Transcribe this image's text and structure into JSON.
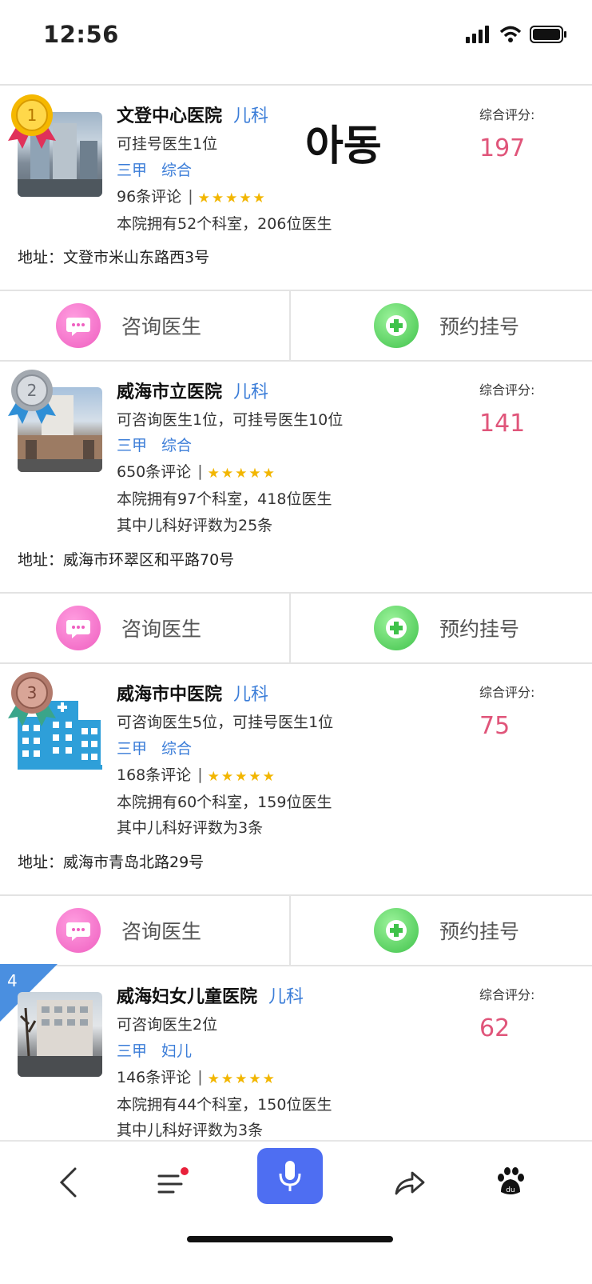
{
  "status_bar": {
    "time": "12:56"
  },
  "overlay_text": "아동",
  "labels": {
    "score_label": "综合评分:",
    "consult": "咨询医生",
    "appointment": "预约挂号"
  },
  "hospitals": [
    {
      "rank": "1",
      "medal": "gold",
      "name": "文登中心医院",
      "dept": "儿科",
      "doctors": "可挂号医生1位",
      "grade": "三甲",
      "type": "综合",
      "reviews": "96条评论",
      "stars": 5,
      "stats": "本院拥有52个科室，206位医生",
      "address": "地址：文登市米山东路西3号",
      "score": "197"
    },
    {
      "rank": "2",
      "medal": "silver",
      "name": "威海市立医院",
      "dept": "儿科",
      "doctors": "可咨询医生1位，可挂号医生10位",
      "grade": "三甲",
      "type": "综合",
      "reviews": "650条评论",
      "stars": 5,
      "stats": "本院拥有97个科室，418位医生",
      "extra": "其中儿科好评数为25条",
      "address": "地址：威海市环翠区和平路70号",
      "score": "141"
    },
    {
      "rank": "3",
      "medal": "bronze",
      "name": "威海市中医院",
      "dept": "儿科",
      "doctors": "可咨询医生5位，可挂号医生1位",
      "grade": "三甲",
      "type": "综合",
      "reviews": "168条评论",
      "stars": 5,
      "stats": "本院拥有60个科室，159位医生",
      "extra": "其中儿科好评数为3条",
      "address": "地址：威海市青岛北路29号",
      "score": "75"
    },
    {
      "rank": "4",
      "name": "威海妇女儿童医院",
      "dept": "儿科",
      "doctors": "可咨询医生2位",
      "grade": "三甲",
      "type": "妇儿",
      "reviews": "146条评论",
      "stars": 5,
      "stats": "本院拥有44个科室，150位医生",
      "extra": "其中儿科好评数为3条",
      "score": "62"
    }
  ],
  "colors": {
    "accent_blue": "#3b7dd8",
    "score_pink": "#e0557a",
    "mic_blue": "#4e6ef2",
    "consult_pink": "#f06fc4",
    "appoint_green": "#4fcf5a"
  },
  "nav_icons": [
    "back-icon",
    "menu-icon",
    "mic-icon",
    "share-icon",
    "baidu-paw-icon"
  ]
}
